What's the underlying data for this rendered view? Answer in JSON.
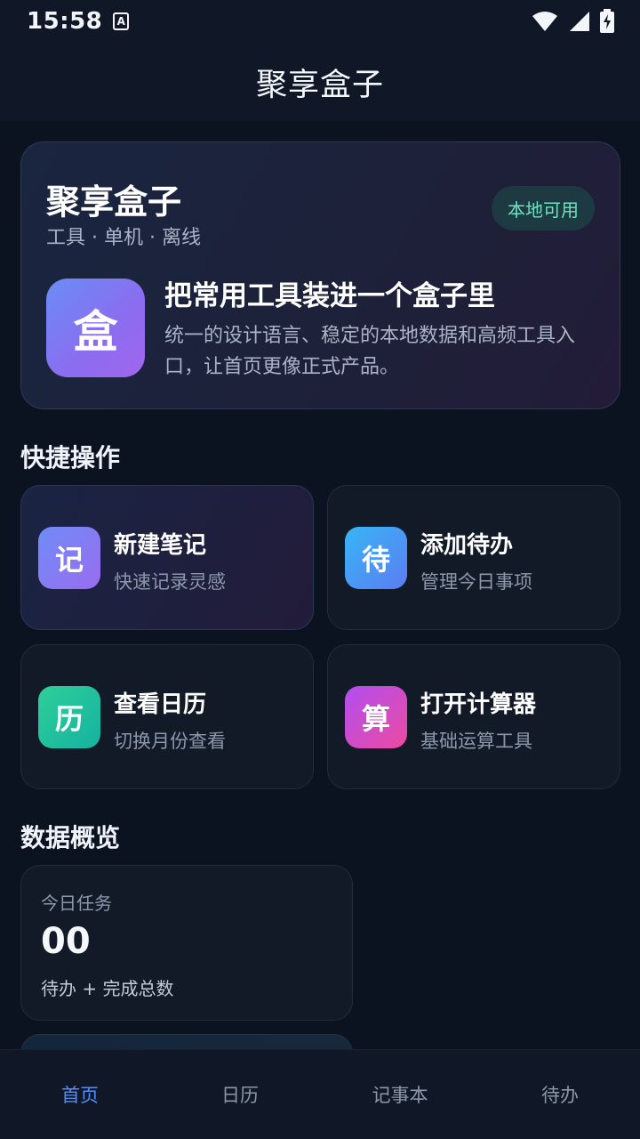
{
  "status_bar": {
    "time": "15:58",
    "notification_icon": "A",
    "icons": [
      "wifi-icon",
      "signal-icon",
      "battery-charging-icon"
    ]
  },
  "header": {
    "title": "聚享盒子"
  },
  "hero": {
    "title": "聚享盒子",
    "subtitle": "工具 · 单机 · 离线",
    "badge": "本地可用",
    "logo_char": "盒",
    "headline": "把常用工具装进一个盒子里",
    "description": "统一的设计语言、稳定的本地数据和高频工具入口，让首页更像正式产品。"
  },
  "quick_actions": {
    "section_title": "快捷操作",
    "items": [
      {
        "icon_char": "记",
        "title": "新建笔记",
        "subtitle": "快速记录灵感",
        "color_from": "#6f8cf6",
        "color_to": "#9a6cf0"
      },
      {
        "icon_char": "待",
        "title": "添加待办",
        "subtitle": "管理今日事项",
        "color_from": "#38b6f5",
        "color_to": "#5b7cf3"
      },
      {
        "icon_char": "历",
        "title": "查看日历",
        "subtitle": "切换月份查看",
        "color_from": "#2ecf9a",
        "color_to": "#15b2a0"
      },
      {
        "icon_char": "算",
        "title": "打开计算器",
        "subtitle": "基础运算工具",
        "color_from": "#b04ef0",
        "color_to": "#ee4aa0"
      }
    ]
  },
  "overview": {
    "section_title": "数据概览",
    "stat": {
      "label": "今日任务",
      "value": "00",
      "description": "待办 + 完成总数"
    }
  },
  "bottom_nav": {
    "items": [
      {
        "label": "首页",
        "active": true
      },
      {
        "label": "日历",
        "active": false
      },
      {
        "label": "记事本",
        "active": false
      },
      {
        "label": "待办",
        "active": false
      }
    ]
  },
  "colors": {
    "background": "#0b1220",
    "accent": "#4f8ff7",
    "badge_text": "#6fe3c0"
  }
}
